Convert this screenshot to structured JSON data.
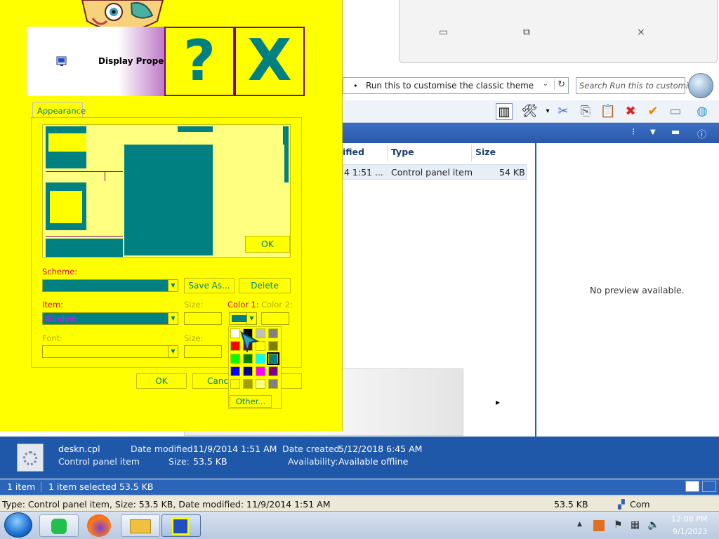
{
  "explorer": {
    "address_text": "Run this to customise the classic theme",
    "search_placeholder": "Search Run this to customise...",
    "columns": [
      "ified",
      "Type",
      "Size"
    ],
    "row": {
      "date": "4 1:51 ...",
      "type": "Control panel item",
      "size": "54 KB"
    },
    "preview_text": "No preview available."
  },
  "details": {
    "filename": "deskn.cpl",
    "filetype": "Control panel item",
    "date_modified_label": "Date modified:",
    "date_modified": "11/9/2014 1:51 AM",
    "size_label": "Size:",
    "size": "53.5 KB",
    "date_created_label": "Date created:",
    "date_created": "5/12/2018 6:45 AM",
    "availability_label": "Availability:",
    "availability": "Available offline"
  },
  "statusbar": {
    "items": "1 item",
    "selected": "1 item selected  53.5 KB"
  },
  "infobar": {
    "text": "Type: Control panel item, Size: 53.5 KB, Date modified: 11/9/2014 1:51 AM",
    "size": "53.5 KB",
    "zone": "Com"
  },
  "taskbar": {
    "time": "12:08 PM",
    "date": "9/1/2023"
  },
  "dialog": {
    "title": "Display Proper...",
    "help_glyph": "?",
    "close_glyph": "X",
    "tab": "Appearance",
    "preview_ok": "OK",
    "scheme_label": "Scheme:",
    "save_as": "Save As...",
    "delete": "Delete",
    "item_label": "Item:",
    "item_value": "Window",
    "size_label": "Size:",
    "color1_label": "Color 1:",
    "color2_label": "Color 2:",
    "font_label": "Font:",
    "font_size_label": "Size:",
    "ok": "OK",
    "cancel": "Cance",
    "other": "Other..."
  },
  "palette": {
    "colors": [
      "#ffffff",
      "#000000",
      "#c0c0c0",
      "#808080",
      "#ff0000",
      "#800000",
      "#ffff00",
      "#808000",
      "#00ff00",
      "#008000",
      "#00ffff",
      "#008080",
      "#0000ff",
      "#000080",
      "#ff00ff",
      "#800080",
      "#ffff00",
      "#a0a000",
      "#ffff80",
      "#808080"
    ],
    "selected_index": 11
  }
}
